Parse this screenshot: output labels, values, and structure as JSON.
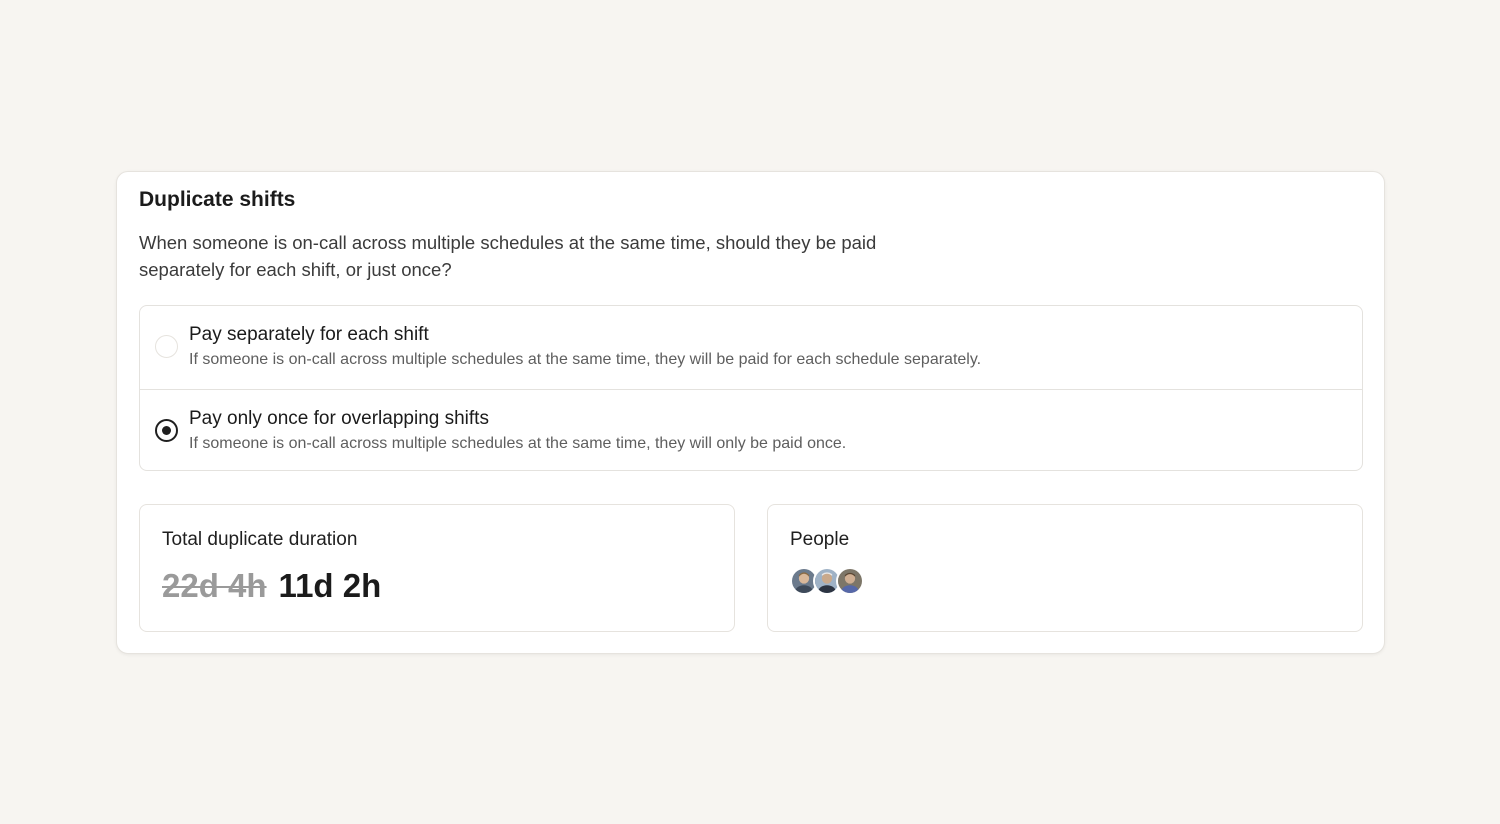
{
  "section": {
    "title": "Duplicate shifts",
    "description": "When someone is on-call across multiple schedules at the same time, should they be paid separately for each shift, or just once?"
  },
  "options": [
    {
      "label": "Pay separately for each shift",
      "help": "If someone is on-call across multiple schedules at the same time, they will be paid for each schedule separately.",
      "selected": false
    },
    {
      "label": "Pay only once for overlapping shifts",
      "help": "If someone is on-call across multiple schedules at the same time, they will only be paid once.",
      "selected": true
    }
  ],
  "duration": {
    "label": "Total duplicate duration",
    "original": "22d 4h",
    "adjusted": "11d 2h"
  },
  "people": {
    "label": "People",
    "avatars": [
      "avatar-person-1",
      "avatar-person-2",
      "avatar-person-3"
    ]
  },
  "colors": {
    "background": "#f7f5f1",
    "accent": "#1f1f1f",
    "muted": "#9a9a9a"
  }
}
